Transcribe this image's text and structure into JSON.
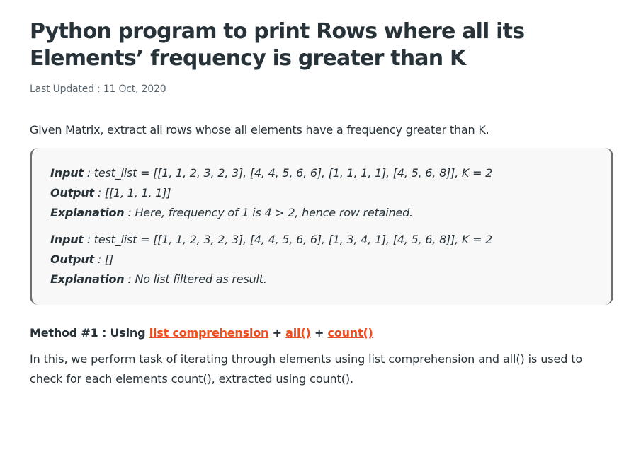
{
  "article": {
    "title": "Python program to print Rows where all its Elements’ frequency is greater than K",
    "updated": "Last Updated : 11 Oct, 2020",
    "intro": "Given Matrix, extract all rows whose all elements have a frequency greater than K.",
    "examples": [
      {
        "input_label": "Input",
        "input_text": " : test_list = [[1, 1, 2, 3, 2, 3], [4, 4, 5, 6, 6], [1, 1, 1, 1], [4, 5, 6, 8]], K = 2",
        "output_label": "Output",
        "output_text": " : [[1, 1, 1, 1]]",
        "explanation_label": "Explanation",
        "explanation_text": " : Here, frequency of 1 is 4 > 2, hence row retained."
      },
      {
        "input_label": "Input",
        "input_text": " : test_list = [[1, 1, 2, 3, 2, 3], [4, 4, 5, 6, 6], [1, 3, 4, 1], [4, 5, 6, 8]], K = 2",
        "output_label": "Output",
        "output_text": " : []",
        "explanation_label": "Explanation",
        "explanation_text": " : No list filtered as result."
      }
    ],
    "method": {
      "prefix": "Method #1 : Using ",
      "link1": "list comprehension",
      "sep1": " + ",
      "link2": "all()",
      "sep2": " + ",
      "link3": "count()"
    },
    "description": "In this, we perform task of iterating through elements using list comprehension and all() is used to check for each elements count(), extracted using count()."
  },
  "colors": {
    "text": "#273239",
    "link": "#ec4e20",
    "example_bg": "#f8f8f8",
    "example_border": "#6f6f6f"
  }
}
